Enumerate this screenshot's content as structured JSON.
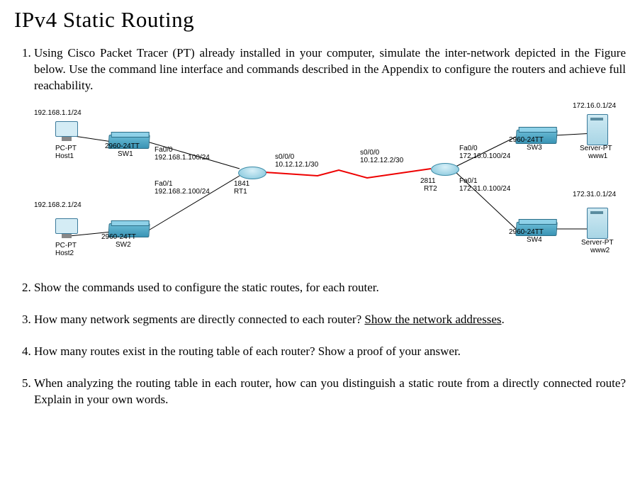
{
  "title": "IPv4 Static Routing",
  "questions": {
    "q1": "Using Cisco Packet Tracer (PT) already installed in your computer, simulate the inter-network depicted in the Figure below. Use the command line interface and commands described in the Appendix to configure the routers and achieve full reachability.",
    "q2": "Show the commands used to configure the static routes, for each router.",
    "q3a": "How many network segments are directly connected to each router? ",
    "q3b": "Show the network addresses",
    "q3c": ".",
    "q4": "How many routes exist in the routing table of each router? Show a proof of your answer.",
    "q5": "When analyzing the routing table in each router, how can you distinguish a static route from a directly connected route? Explain in your own words."
  },
  "diagram": {
    "host1_ip": "192.168.1.1/24",
    "host1_type": "PC-PT",
    "host1_name": "Host1",
    "sw1_model": "2960-24TT",
    "sw1_name": "SW1",
    "rt1_fa0_0": "Fa0/0",
    "rt1_fa0_0_ip": "192.168.1.100/24",
    "rt1_fa0_1": "Fa0/1",
    "rt1_fa0_1_ip": "192.168.2.100/24",
    "rt1_model": "1841",
    "rt1_name": "RT1",
    "rt1_s000": "s0/0/0",
    "rt1_s000_ip": "10.12.12.1/30",
    "rt2_s000": "s0/0/0",
    "rt2_s000_ip": "10.12.12.2/30",
    "rt2_fa0_0": "Fa0/0",
    "rt2_fa0_0_ip": "172.16.0.100/24",
    "rt2_fa0_1": "Fa0/1",
    "rt2_fa0_1_ip": "172.31.0.100/24",
    "rt2_model": "2811",
    "rt2_name": "RT2",
    "host2_ip": "192.168.2.1/24",
    "host2_type": "PC-PT",
    "host2_name": "Host2",
    "sw2_model": "2960-24TT",
    "sw2_name": "SW2",
    "sw3_model": "2960-24TT",
    "sw3_name": "SW3",
    "sw4_model": "2960-24TT",
    "sw4_name": "SW4",
    "www1_ip": "172.16.0.1/24",
    "www1_type": "Server-PT",
    "www1_name": "www1",
    "www2_ip": "172.31.0.1/24",
    "www2_type": "Server-PT",
    "www2_name": "www2"
  }
}
